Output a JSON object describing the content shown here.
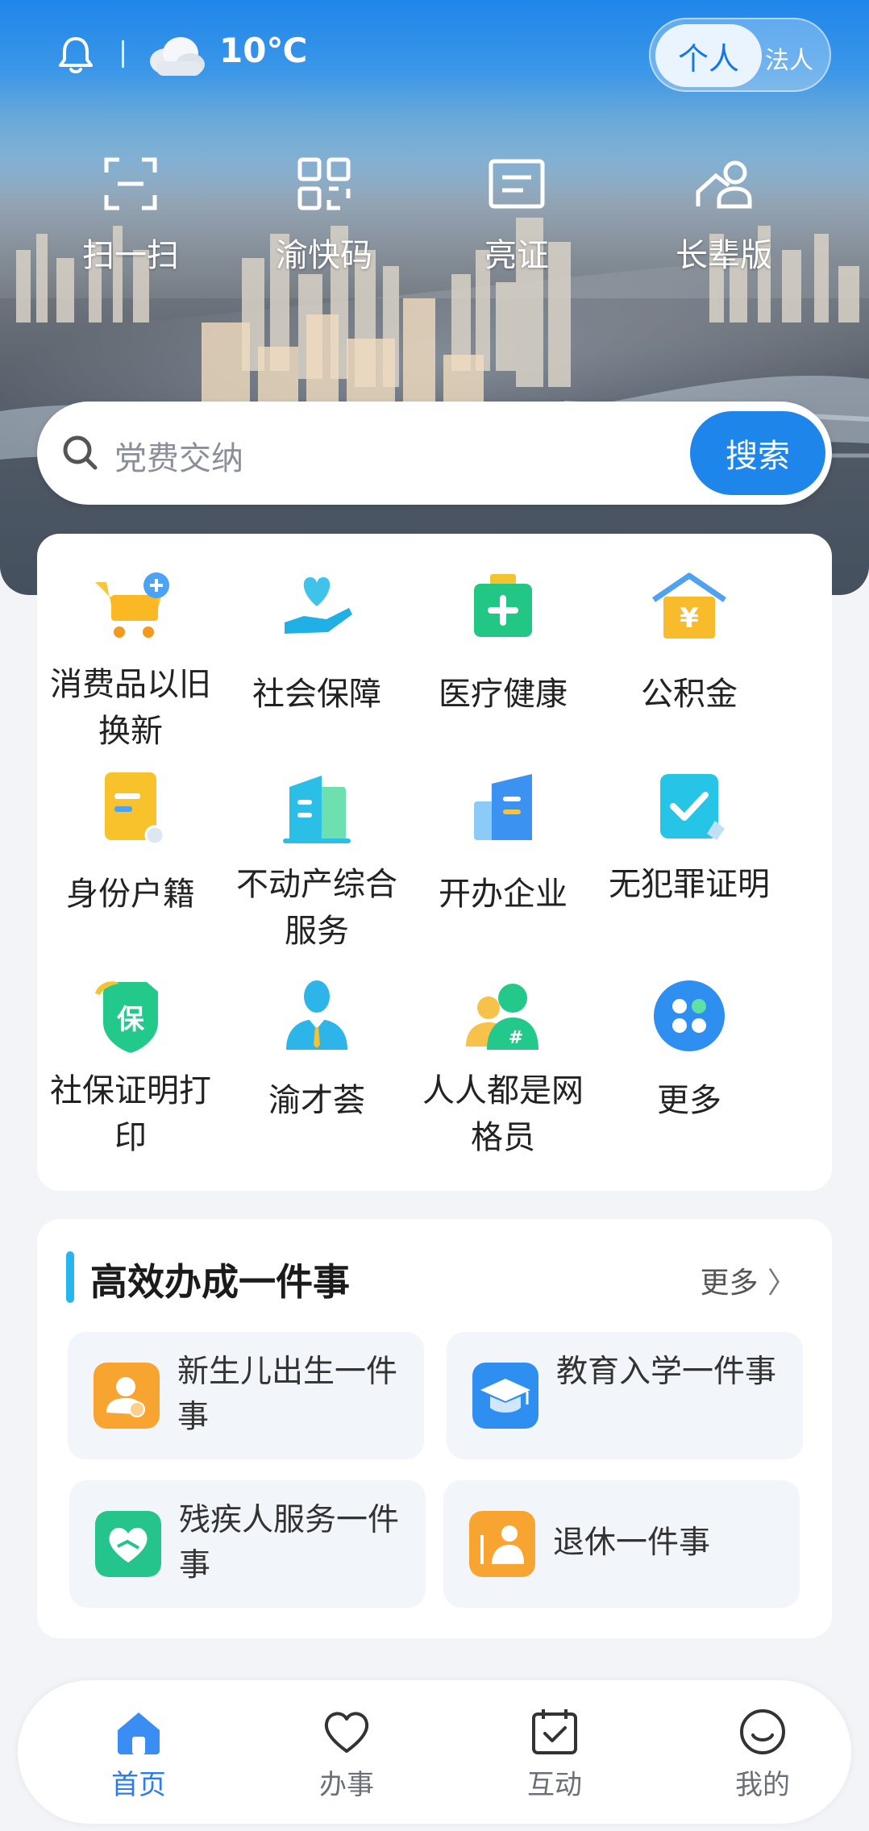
{
  "status": {
    "temperature": "10℃"
  },
  "role_switch": {
    "personal": "个人",
    "legal": "法人"
  },
  "quick_actions": [
    {
      "label": "扫一扫",
      "icon": "scan-icon"
    },
    {
      "label": "渝快码",
      "icon": "qrcode-icon"
    },
    {
      "label": "亮证",
      "icon": "id-card-icon"
    },
    {
      "label": "长辈版",
      "icon": "elder-icon"
    }
  ],
  "search": {
    "placeholder": "党费交纳",
    "button": "搜索"
  },
  "services": [
    {
      "label": "消费品以旧换新",
      "icon": "cart-plus-icon"
    },
    {
      "label": "社会保障",
      "icon": "heart-hand-icon"
    },
    {
      "label": "医疗健康",
      "icon": "medical-kit-icon"
    },
    {
      "label": "公积金",
      "icon": "house-yen-icon"
    },
    {
      "label": "身份户籍",
      "icon": "id-document-icon"
    },
    {
      "label": "不动产综合服务",
      "icon": "building-icon"
    },
    {
      "label": "开办企业",
      "icon": "enterprise-icon"
    },
    {
      "label": "无犯罪证明",
      "icon": "certificate-check-icon"
    },
    {
      "label": "社保证明打印",
      "icon": "shield-bao-icon"
    },
    {
      "label": "渝才荟",
      "icon": "talent-person-icon"
    },
    {
      "label": "人人都是网格员",
      "icon": "grid-member-icon"
    },
    {
      "label": "更多",
      "icon": "more-apps-icon"
    }
  ],
  "efficient": {
    "title": "高效办成一件事",
    "more": "更多",
    "items": [
      {
        "label": "新生儿出生一件事",
        "icon": "newborn-icon"
      },
      {
        "label": "教育入学一件事",
        "icon": "graduation-cap-icon"
      },
      {
        "label": "残疾人服务一件事",
        "icon": "disability-heart-icon"
      },
      {
        "label": "退休一件事",
        "icon": "retirement-icon"
      }
    ]
  },
  "nav": [
    {
      "label": "首页",
      "icon": "home-icon"
    },
    {
      "label": "办事",
      "icon": "heart-icon"
    },
    {
      "label": "互动",
      "icon": "calendar-check-icon"
    },
    {
      "label": "我的",
      "icon": "smile-icon"
    }
  ],
  "colors": {
    "primary": "#1e86ea",
    "accent_bar": "#27b5f0",
    "nav_active": "#2a7cf0"
  }
}
